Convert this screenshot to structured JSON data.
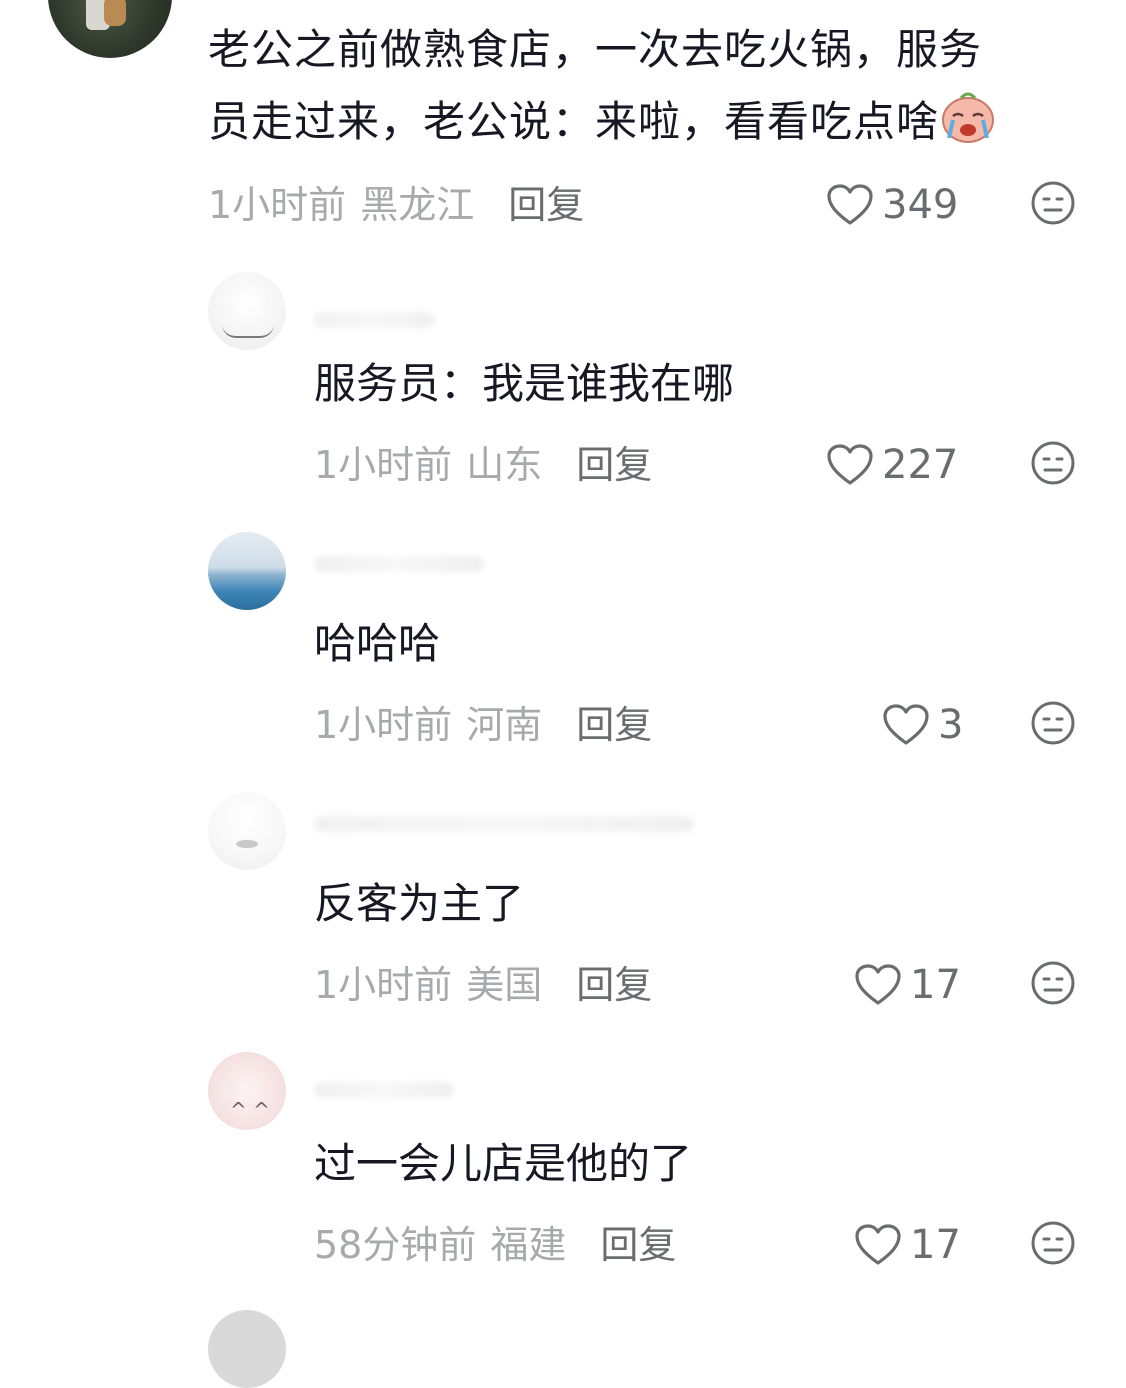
{
  "comments": [
    {
      "text_line1": "老公之前做熟食店，一次去吃火锅，服务",
      "text_line2": "员走过来，老公说：来啦，看看吃点啥",
      "time": "1小时前",
      "location": "黑龙江",
      "reply_label": "回复",
      "likes": "349",
      "emoji_icon": "crying-face-emoji-icon"
    },
    {
      "text": "服务员：我是谁我在哪",
      "time": "1小时前",
      "location": "山东",
      "reply_label": "回复",
      "likes": "227"
    },
    {
      "text": "哈哈哈",
      "time": "1小时前",
      "location": "河南",
      "reply_label": "回复",
      "likes": "3"
    },
    {
      "text": "反客为主了",
      "time": "1小时前",
      "location": "美国",
      "reply_label": "回复",
      "likes": "17"
    },
    {
      "text": "过一会儿店是他的了",
      "time": "58分钟前",
      "location": "福建",
      "reply_label": "回复",
      "likes": "17"
    }
  ],
  "icons": {
    "like": "heart-outline-icon",
    "dislike": "neutral-face-icon"
  },
  "colors": {
    "text_primary": "#161823",
    "meta_gray": "#a8a9ac",
    "action_gray": "#6b6c70"
  }
}
